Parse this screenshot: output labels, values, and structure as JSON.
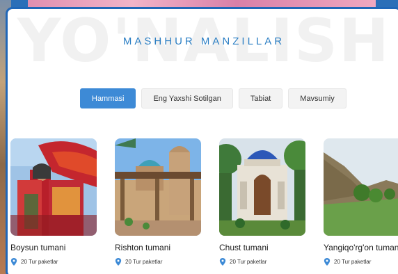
{
  "watermark": "YO'NALISH",
  "section_title": "MASHHUR MANZILLAR",
  "tabs": [
    {
      "label": "Hammasi",
      "active": true
    },
    {
      "label": "Eng Yaxshi Sotilgan",
      "active": false
    },
    {
      "label": "Tabiat",
      "active": false
    },
    {
      "label": "Mavsumiy",
      "active": false
    }
  ],
  "destinations": [
    {
      "name": "Boysun tumani",
      "packages": "20 Tur paketlar"
    },
    {
      "name": "Rishton tumani",
      "packages": "20 Tur paketlar"
    },
    {
      "name": "Chust tumani",
      "packages": "20 Tur paketlar"
    },
    {
      "name": "Yangiqo'rg'on tumani",
      "packages": "20 Tur paketlar"
    }
  ],
  "colors": {
    "accent": "#3d8ad6",
    "frame": "#2067b8",
    "pin": "#3d8ad6"
  },
  "icons": {
    "pin": "map-pin-icon"
  }
}
